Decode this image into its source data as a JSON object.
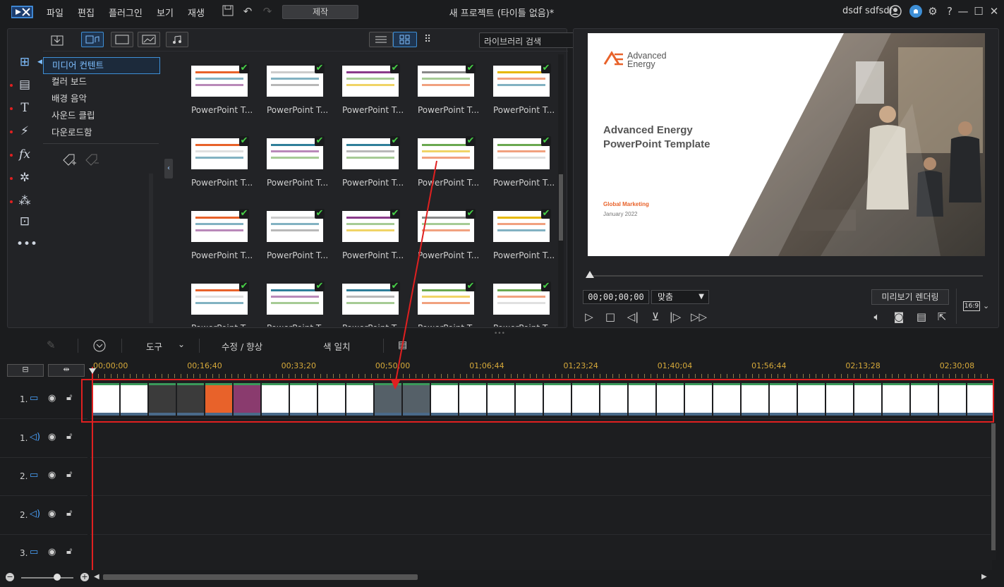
{
  "menu": {
    "items": [
      "파일",
      "편집",
      "플러그인",
      "보기",
      "재생"
    ],
    "produce_label": "제작",
    "title": "새 프로젝트 (타이틀 없음)*",
    "user": "dsdf sdfsdf"
  },
  "library": {
    "search_placeholder": "라이브러리 검색",
    "categories": [
      "미디어 컨텐트",
      "컬러 보드",
      "배경 음악",
      "사운드 클립",
      "다운로드함"
    ],
    "thumbnail_label": "PowerPoint T..."
  },
  "preview": {
    "slide_logo_line1": "Advanced",
    "slide_logo_line2": "Energy",
    "slide_title_line1": "Advanced Energy",
    "slide_title_line2": "PowerPoint Template",
    "slide_subtitle": "Global Marketing",
    "slide_date": "January 2022",
    "timecode": "00;00;00;00",
    "fit_option": "맞춤",
    "render_label": "미리보기 렌더링",
    "aspect": "16:9"
  },
  "timeline_toolbar": {
    "tools_label": "도구",
    "fix_label": "수정 / 향상",
    "color_match_label": "색 일치"
  },
  "ruler": {
    "ticks": [
      "00;00;00",
      "00;16;40",
      "00;33;20",
      "00;50;00",
      "01;06;44",
      "01;23;24",
      "01;40;04",
      "01;56;44",
      "02;13;28",
      "02;30;08"
    ]
  },
  "tracks": [
    {
      "num": "1.",
      "type": "video"
    },
    {
      "num": "1.",
      "type": "audio"
    },
    {
      "num": "2.",
      "type": "video"
    },
    {
      "num": "2.",
      "type": "audio"
    },
    {
      "num": "3.",
      "type": "video"
    }
  ],
  "colors": {
    "accent": "#3e8fd6",
    "brand_orange": "#e8622a",
    "highlight_red": "#e02020",
    "check_green": "#47d147"
  }
}
